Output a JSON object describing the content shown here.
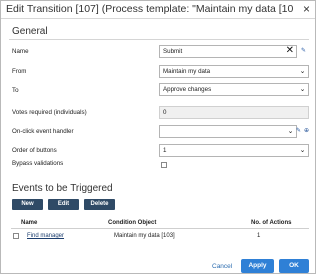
{
  "dialog": {
    "title": "Edit Transition [107] (Process template: \"Maintain my data [10...",
    "close_glyph": "×"
  },
  "general": {
    "title": "General",
    "name": {
      "label": "Name",
      "value": "Submit"
    },
    "from": {
      "label": "From",
      "value": "Maintain my data"
    },
    "to": {
      "label": "To",
      "value": "Approve changes"
    },
    "votes": {
      "label": "Votes required (individuals)",
      "value": "0"
    },
    "onclick": {
      "label": "On-click event handler",
      "value": ""
    },
    "order": {
      "label": "Order of buttons",
      "value": "1"
    },
    "bypass": {
      "label": "Bypass validations",
      "checked": false
    }
  },
  "events": {
    "title": "Events to be Triggered",
    "buttons": {
      "new": "New",
      "edit": "Edit",
      "delete": "Delete"
    },
    "columns": {
      "name": "Name",
      "condition": "Condition Object",
      "actions": "No. of Actions"
    },
    "rows": [
      {
        "name": "Find manager",
        "condition": "Maintain my data [103]",
        "actions": "1"
      }
    ]
  },
  "footer": {
    "cancel": "Cancel",
    "apply": "Apply",
    "ok": "OK"
  },
  "colors": {
    "dark_button": "#2f4a66",
    "primary_button": "#2f80d6",
    "link": "#1b3d6e"
  },
  "icons": {
    "title_close": "close-icon",
    "name_clear": "clear-icon",
    "name_edit": "edit-icon",
    "onclick_edit": "edit-icon",
    "onclick_add": "add-icon",
    "dropdown": "chevron-down-icon"
  }
}
